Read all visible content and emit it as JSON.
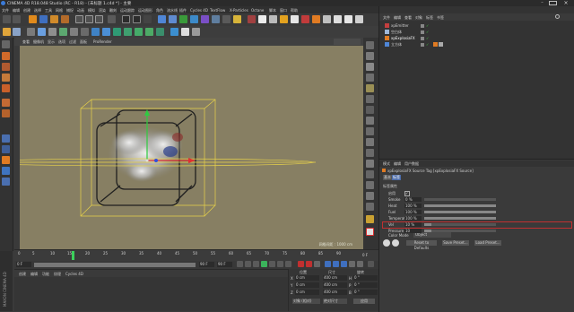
{
  "title": "CINEMA 4D R18.048 Studio (RC - R18) - [未标题 1.c4d *] - 主要",
  "menu": [
    "文件",
    "编辑",
    "创建",
    "选择",
    "工具",
    "网格",
    "捕捉",
    "动画",
    "模拟",
    "渲染",
    "雕刻",
    "运动跟踪",
    "运动图形",
    "角色",
    "流水线",
    "插件",
    "Cycles 4D",
    "TextFlow",
    "X-Particles",
    "Octane",
    "脚本",
    "窗口",
    "帮助"
  ],
  "viewport": {
    "menu": [
      "查看",
      "摄像机",
      "显示",
      "选项",
      "过滤",
      "面板",
      "ProRender"
    ],
    "grid_label": "网格间距 : 1000 cm"
  },
  "timeline": {
    "ticks": [
      "0",
      "5",
      "10",
      "15",
      "20",
      "25",
      "30",
      "35",
      "40",
      "45",
      "50",
      "55",
      "60",
      "65",
      "70",
      "75",
      "80",
      "85",
      "90"
    ],
    "end_label": "0 F",
    "current_frame": "0 F",
    "start_field": "0 F",
    "end_field": "90 F",
    "max_field": "90 F",
    "playhead_frame": 15
  },
  "material_menu": [
    "创建",
    "编辑",
    "功能",
    "纹理",
    "Cycles 4D"
  ],
  "coordinates": {
    "headers": [
      "位置",
      "尺寸",
      "旋转"
    ],
    "rows": [
      {
        "axis": "X",
        "pos": "0 cm",
        "size": "400 cm",
        "rot_label": "H",
        "rot": "0 °"
      },
      {
        "axis": "Y",
        "pos": "0 cm",
        "size": "400 cm",
        "rot_label": "P",
        "rot": "0 °"
      },
      {
        "axis": "Z",
        "pos": "0 cm",
        "size": "400 cm",
        "rot_label": "B",
        "rot": "0 °"
      }
    ],
    "mode": "对象 (相对)",
    "size_mode": "绝对尺寸",
    "apply": "应用"
  },
  "object_manager": {
    "menu": [
      "文件",
      "编辑",
      "查看",
      "对象",
      "标签",
      "书签"
    ],
    "objects": [
      {
        "name": "xpEmitter"
      },
      {
        "name": "空白体"
      },
      {
        "name": "xpExplosiaFX"
      },
      {
        "name": "立方体"
      }
    ]
  },
  "attributes": {
    "menu": [
      "模式",
      "编辑",
      "用户数据"
    ],
    "tag_title": "xpExplosiaFX Source Tag [xpExplosiaFX Source]",
    "tabs": [
      "基本",
      "标签"
    ],
    "section": "标签属性",
    "enabled_label": "启用",
    "fields": [
      {
        "label": "Smoke",
        "value": "0 %",
        "fraction": 0.0
      },
      {
        "label": "Heat",
        "value": "100 %",
        "fraction": 1.0
      },
      {
        "label": "Fuel",
        "value": "100 %",
        "fraction": 1.0
      },
      {
        "label": "Temperature",
        "value": "100 %",
        "fraction": 1.0
      },
      {
        "label": "Vel",
        "value": "10 %",
        "fraction": 0.1
      },
      {
        "label": "Pressure",
        "value": "10",
        "fraction": 0.1
      }
    ],
    "color_mode_label": "Color Mode",
    "color_mode_value": "Object",
    "buttons": [
      "Reset to Defaults",
      "Save Preset...",
      "Load Preset..."
    ]
  },
  "logo_text": "MAXON CINEMA 4D"
}
